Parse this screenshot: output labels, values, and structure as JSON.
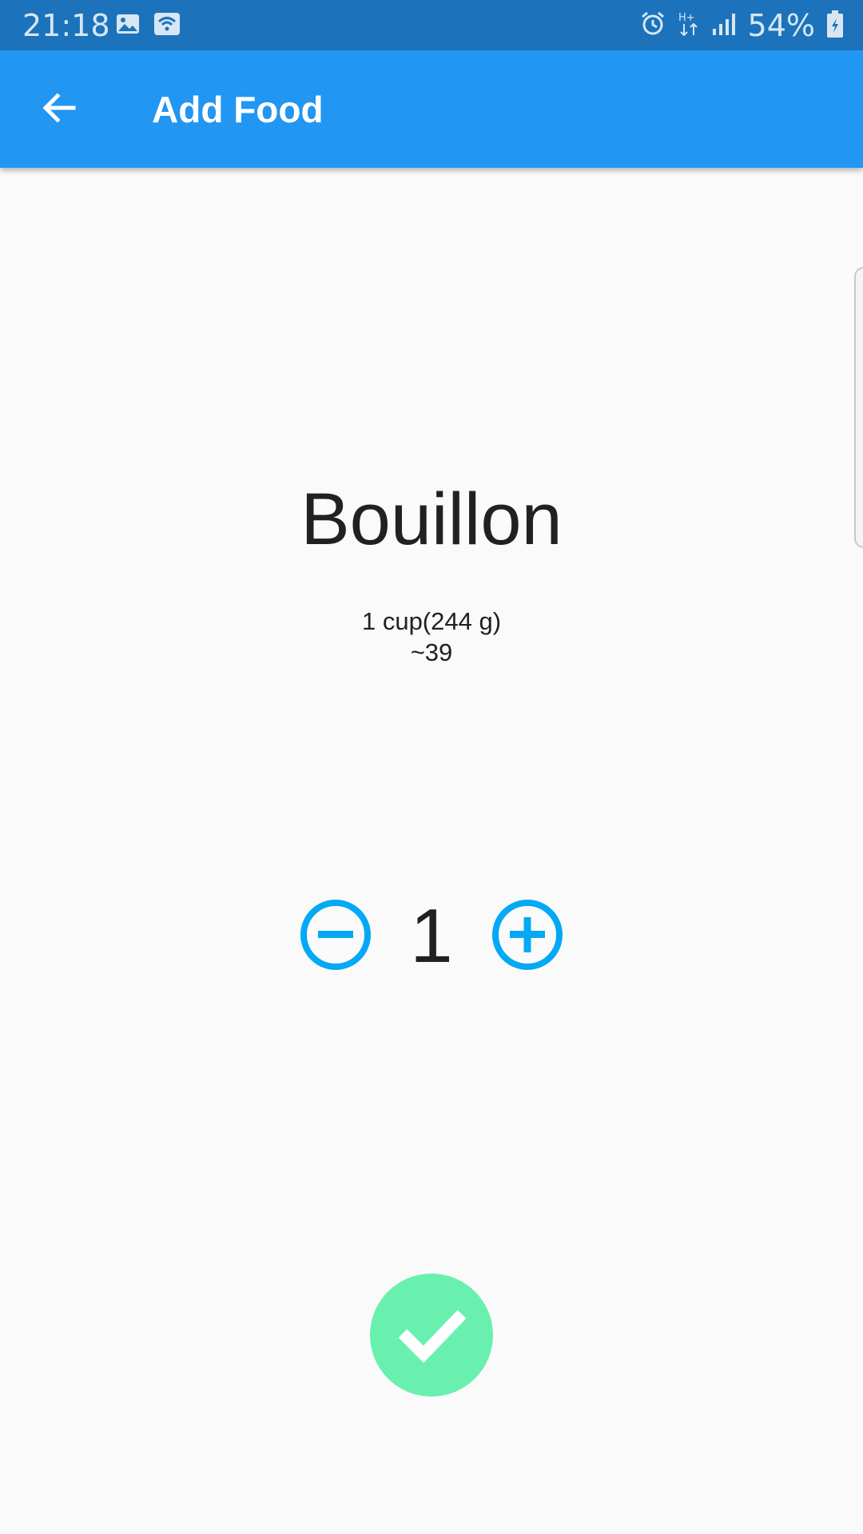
{
  "status_bar": {
    "time": "21:18",
    "battery_percent": "54%",
    "icons": [
      "image-icon",
      "wifi-icon",
      "alarm-icon",
      "data-h-plus-icon",
      "signal-icon",
      "battery-charging-icon"
    ]
  },
  "app_bar": {
    "title": "Add Food",
    "back_icon": "arrow-back-icon",
    "background": "#2196f3"
  },
  "food": {
    "name": "Bouillon",
    "serving": "1 cup(244 g)",
    "calories": "~39"
  },
  "stepper": {
    "quantity": "1",
    "minus_icon": "remove-circle-icon",
    "plus_icon": "add-circle-icon",
    "accent": "#03a9f4"
  },
  "confirm": {
    "icon": "check-icon",
    "color": "#69f0ae"
  }
}
